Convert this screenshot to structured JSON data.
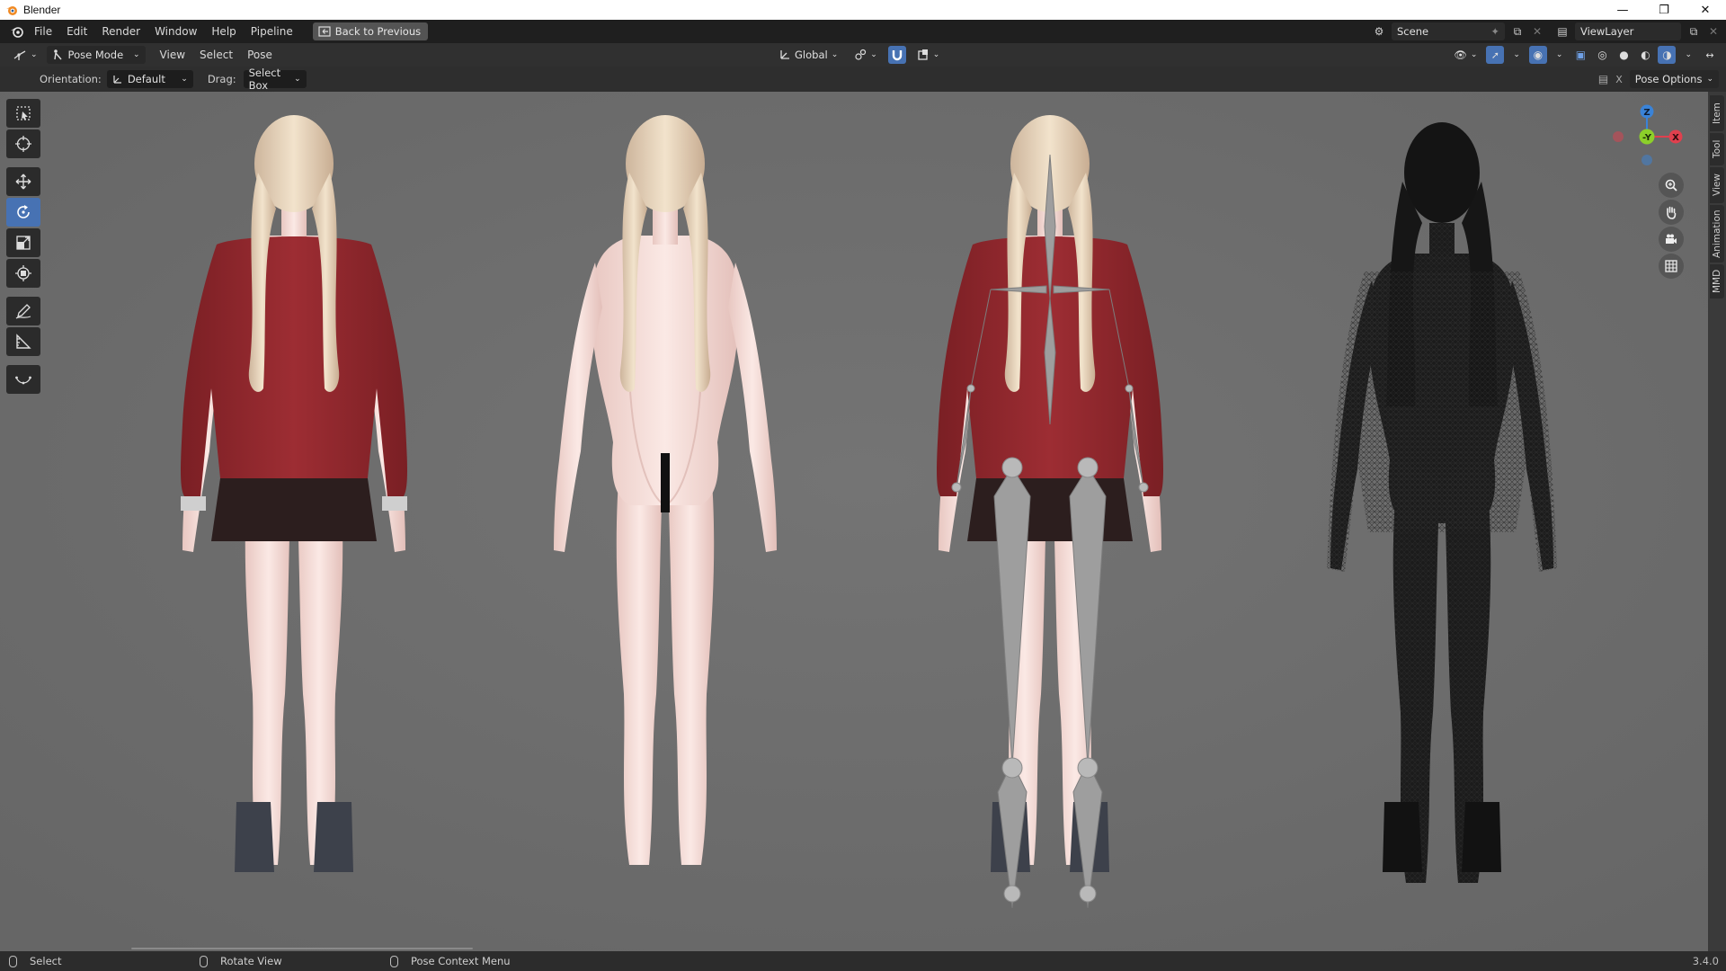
{
  "window": {
    "title": "Blender",
    "controls": [
      "minimize-icon",
      "restore-icon",
      "close-icon"
    ]
  },
  "topbar": {
    "menus": [
      "File",
      "Edit",
      "Render",
      "Window",
      "Help",
      "Pipeline"
    ],
    "back_button": "Back to Previous",
    "scene": "Scene",
    "view_layer": "ViewLayer"
  },
  "header": {
    "mode": "Pose Mode",
    "menus": [
      "View",
      "Select",
      "Pose"
    ],
    "transform_orientation": "Global",
    "pose_options": "Pose Options"
  },
  "tool_settings": {
    "orientation_label": "Orientation:",
    "orientation_value": "Default",
    "drag_label": "Drag:",
    "drag_value": "Select Box"
  },
  "toolbar": {
    "tools": [
      "select-box-tool",
      "cursor-tool",
      "move-tool",
      "rotate-tool",
      "scale-tool",
      "transform-tool",
      "annotate-tool",
      "measure-tool",
      "relax-pose-tool"
    ],
    "active": "rotate-tool"
  },
  "sidebar_tabs": [
    "Item",
    "Tool",
    "View",
    "Animation",
    "MMD"
  ],
  "navigation_gizmo": {
    "axes": [
      "Z",
      "Y",
      "X"
    ],
    "colors": {
      "x": "#e0404e",
      "y": "#8ccf2a",
      "z": "#3a83d8"
    }
  },
  "viewport": {
    "figures": [
      "textured-back-view",
      "skin-back-view",
      "armature-overlay-view",
      "wireframe-back-view"
    ]
  },
  "statusbar": {
    "left": "Select",
    "middle": "Rotate View",
    "right": "Pose Context Menu",
    "version": "3.4.0"
  }
}
